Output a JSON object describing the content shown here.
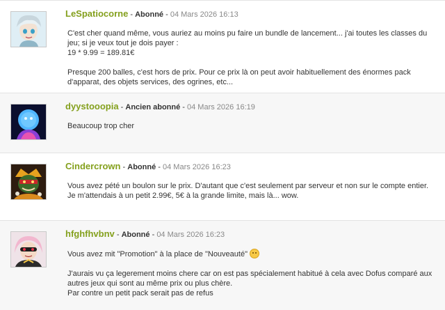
{
  "posts": [
    {
      "author": "LeSpatiocorne",
      "rank": "Abonné",
      "separator": "-",
      "date": "04 Mars 2026 16:13",
      "paragraphs": [
        "C'est cher quand même, vous auriez au moins pu faire un bundle de lancement... j'ai toutes les classes du jeu; si je veux tout je dois payer :",
        "19 * 9.99 = 189.81€",
        "Presque 200 balles, c'est hors de prix. Pour ce prix là on peut avoir habituellement des énormes pack d'apparat, des objets services, des ogrines, etc..."
      ]
    },
    {
      "author": "dyystooopia",
      "rank": "Ancien abonné",
      "separator": "-",
      "date": "04 Mars 2026 16:19",
      "paragraphs": [
        "Beaucoup trop cher"
      ]
    },
    {
      "author": "Cindercrown",
      "rank": "Abonné",
      "separator": "-",
      "date": "04 Mars 2026 16:23",
      "paragraphs": [
        "Vous avez pété un boulon sur le prix. D'autant que c'est seulement par serveur et non sur le compte entier. Je m'attendais à un petit 2.99€, 5€ à la grande limite, mais là... wow."
      ]
    },
    {
      "author": "hfghfhvbnv",
      "rank": "Abonné",
      "separator": "-",
      "date": "04 Mars 2026 16:23",
      "paragraphs": [
        "Vous avez mit \"Promotion\" à la place de \"Nouveauté\"",
        "J'aurais vu ça legerement moins chere car on est pas spécialement habitué à cela avec Dofus comparé aux autres jeux qui sont au même prix ou plus chère.",
        "Par contre un petit pack serait pas de refus"
      ]
    }
  ]
}
